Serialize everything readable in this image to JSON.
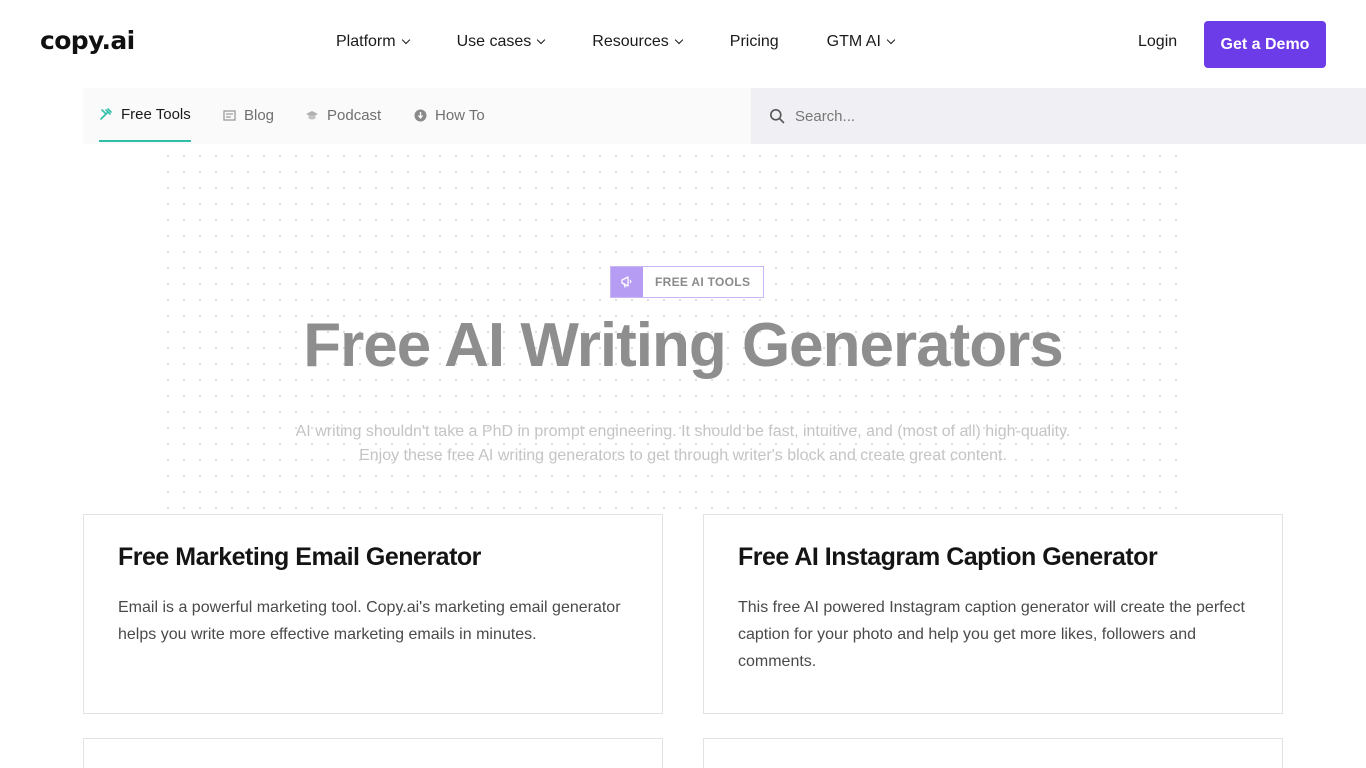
{
  "brand": {
    "logo": "copy.ai",
    "accent": "#6c3ce9",
    "tab_underline": "#2fbfa8"
  },
  "nav": {
    "items": [
      {
        "label": "Platform",
        "has_dropdown": true
      },
      {
        "label": "Use cases",
        "has_dropdown": true
      },
      {
        "label": "Resources",
        "has_dropdown": true
      },
      {
        "label": "Pricing",
        "has_dropdown": false
      },
      {
        "label": "GTM AI",
        "has_dropdown": true
      }
    ],
    "login": "Login",
    "demo": "Get a Demo"
  },
  "subnav": {
    "tabs": [
      {
        "label": "Free Tools",
        "icon": "tools-icon",
        "active": true
      },
      {
        "label": "Blog",
        "icon": "blog-icon",
        "active": false
      },
      {
        "label": "Podcast",
        "icon": "podcast-icon",
        "active": false
      },
      {
        "label": "How To",
        "icon": "how-to-icon",
        "active": false
      }
    ],
    "search_placeholder": "Search..."
  },
  "hero": {
    "badge": "FREE AI TOOLS",
    "title": "Free AI Writing Generators",
    "subtitle_line1": "AI writing shouldn't take a PhD in prompt engineering. It should be fast, intuitive, and (most of all) high-quality.",
    "subtitle_line2": "Enjoy these free AI writing generators to get through writer's block and create great content."
  },
  "cards": [
    {
      "title": "Free Marketing Email Generator",
      "description": "Email is a powerful marketing tool. Copy.ai's marketing email generator helps you write more effective marketing emails in minutes."
    },
    {
      "title": "Free AI Instagram Caption Generator",
      "description": "This free AI powered Instagram caption generator will create the perfect caption for your photo and help you get more likes, followers and comments."
    }
  ]
}
